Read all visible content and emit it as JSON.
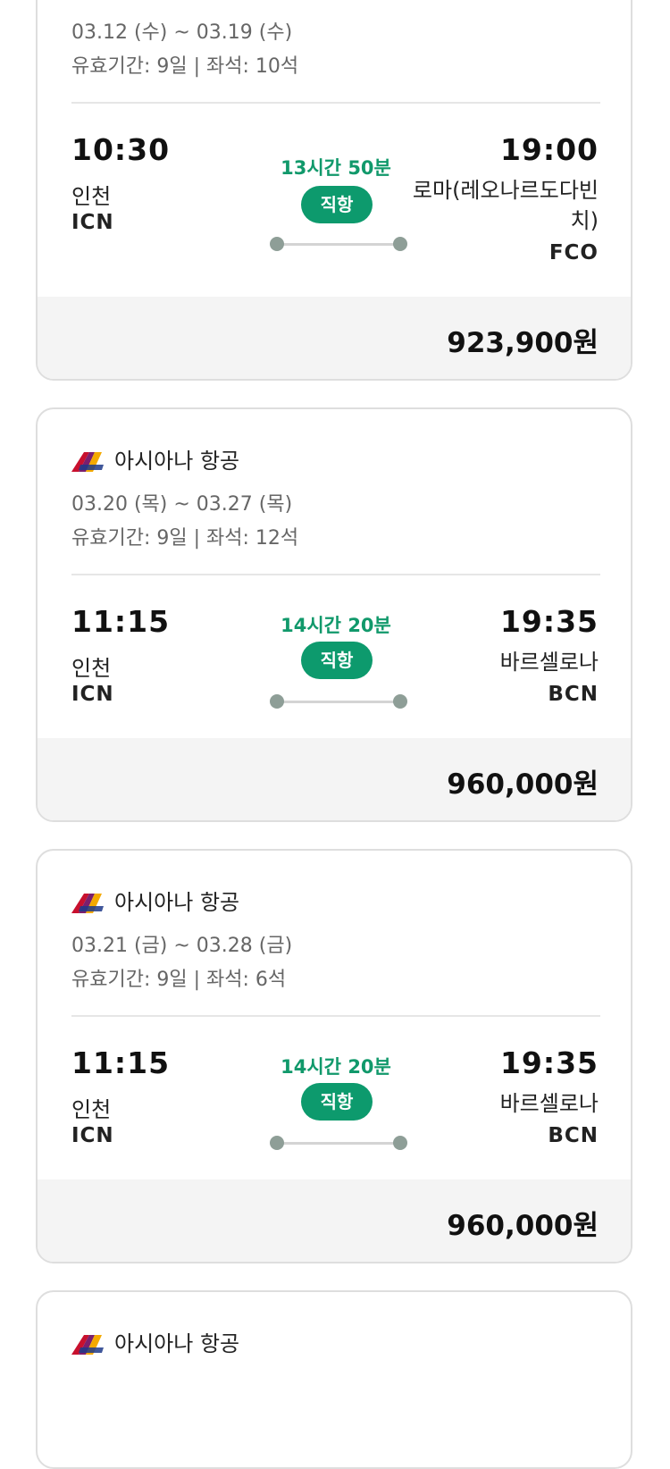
{
  "cards": [
    {
      "airline": "",
      "dates": "03.12 (수) ~ 03.19 (수)",
      "validity": "유효기간: 9일 | 좌석: 10석",
      "dep_time": "10:30",
      "dep_city": "인천",
      "dep_code": "ICN",
      "duration": "13시간 50분",
      "direct": "직항",
      "arr_time": "19:00",
      "arr_city": "로마(레오나르도다빈치)",
      "arr_code": "FCO",
      "price": "923,900원"
    },
    {
      "airline": "아시아나 항공",
      "dates": "03.20 (목) ~ 03.27 (목)",
      "validity": "유효기간: 9일 | 좌석: 12석",
      "dep_time": "11:15",
      "dep_city": "인천",
      "dep_code": "ICN",
      "duration": "14시간 20분",
      "direct": "직항",
      "arr_time": "19:35",
      "arr_city": "바르셀로나",
      "arr_code": "BCN",
      "price": "960,000원"
    },
    {
      "airline": "아시아나 항공",
      "dates": "03.21 (금) ~ 03.28 (금)",
      "validity": "유효기간: 9일 | 좌석: 6석",
      "dep_time": "11:15",
      "dep_city": "인천",
      "dep_code": "ICN",
      "duration": "14시간 20분",
      "direct": "직항",
      "arr_time": "19:35",
      "arr_city": "바르셀로나",
      "arr_code": "BCN",
      "price": "960,000원"
    },
    {
      "airline": "아시아나 항공"
    }
  ],
  "icons": {
    "airline_logo": "asiana-logo-icon"
  },
  "colors": {
    "accent_green": "#0d9a6d",
    "duration_green": "#11996b",
    "dot_gray": "#8e9e97"
  }
}
